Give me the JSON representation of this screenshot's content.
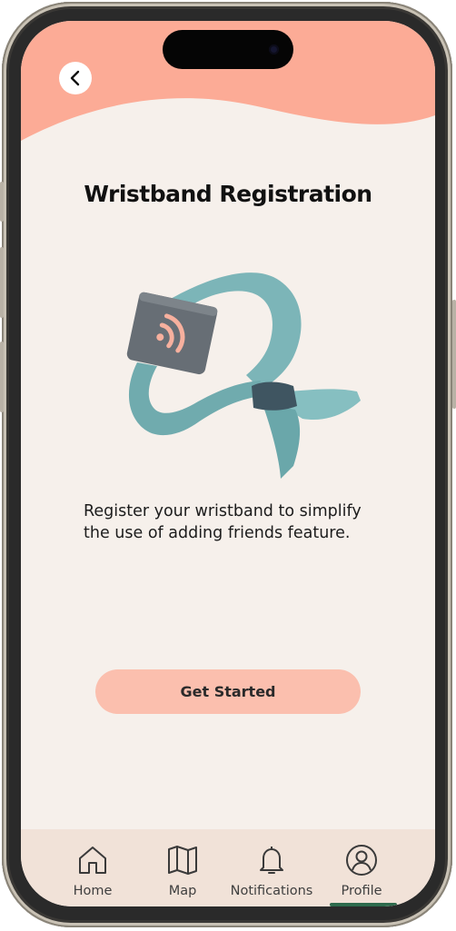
{
  "header": {
    "back_icon": "chevron-left-icon",
    "accent_color": "#fcab96"
  },
  "main": {
    "title": "Wristband Registration",
    "illustration": "wristband-illustration",
    "description_lines": [
      "Register your wristband to simplify",
      "the use of adding friends feature."
    ],
    "cta_label": "Get Started",
    "cta_color": "#fbbfae"
  },
  "tab_bar": {
    "active": "Profile",
    "indicator_color": "#2e6b4d",
    "items": [
      {
        "label": "Home",
        "icon": "home-icon"
      },
      {
        "label": "Map",
        "icon": "map-icon"
      },
      {
        "label": "Notifications",
        "icon": "bell-icon"
      },
      {
        "label": "Profile",
        "icon": "profile-icon"
      }
    ]
  }
}
